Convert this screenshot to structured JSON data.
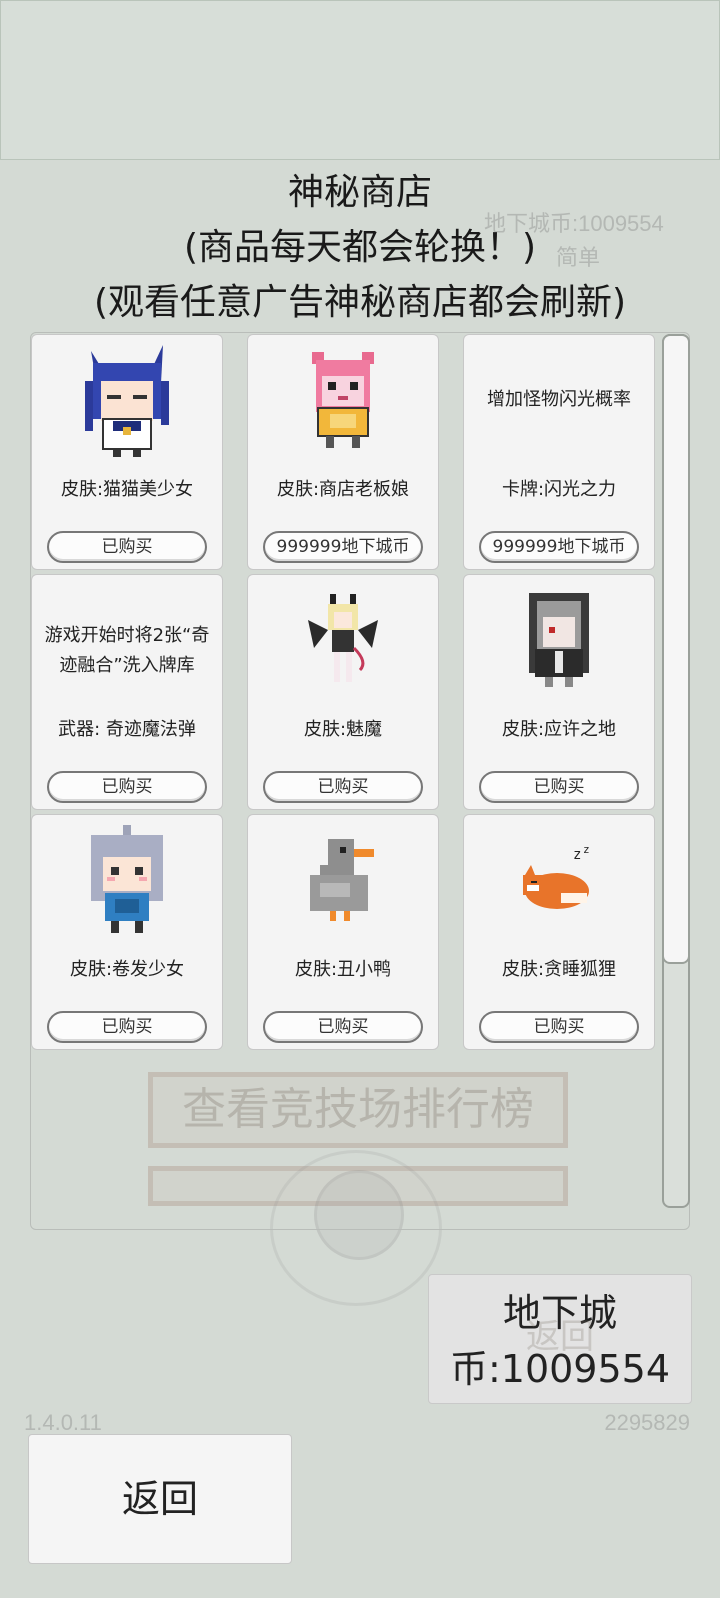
{
  "title": {
    "line1": "神秘商店",
    "line2": "(商品每天都会轮换！)",
    "line3": "(观看任意广告神秘商店都会刷新)"
  },
  "background": {
    "coin_text": "地下城币:1009554",
    "difficulty": "简单",
    "menu_big": [
      "查看竞技场排行榜"
    ],
    "ghost_back": "返回"
  },
  "items": [
    {
      "label": "皮肤:猫猫美少女",
      "button": "已购买",
      "art": "cat-girl-icon"
    },
    {
      "label": "皮肤:商店老板娘",
      "button": "999999地下城币",
      "art": "shop-lady-icon"
    },
    {
      "desc": "增加怪物闪光概率",
      "label": "卡牌:闪光之力",
      "button": "999999地下城币"
    },
    {
      "desc": "游戏开始时将2张“奇迹融合”洗入牌库",
      "label": "武器: 奇迹魔法弹",
      "button": "已购买"
    },
    {
      "label": "皮肤:魅魔",
      "button": "已购买",
      "art": "succubus-icon"
    },
    {
      "label": "皮肤:应许之地",
      "button": "已购买",
      "art": "hooded-girl-icon"
    },
    {
      "label": "皮肤:卷发少女",
      "button": "已购买",
      "art": "curly-girl-icon"
    },
    {
      "label": "皮肤:丑小鸭",
      "button": "已购买",
      "art": "duck-icon"
    },
    {
      "label": "皮肤:贪睡狐狸",
      "button": "已购买",
      "art": "sleeping-fox-icon"
    }
  ],
  "coins": {
    "line1": "地下城",
    "line2": "币:1009554"
  },
  "version": "1.4.0.11",
  "id_number": "2295829",
  "back_label": "返回"
}
